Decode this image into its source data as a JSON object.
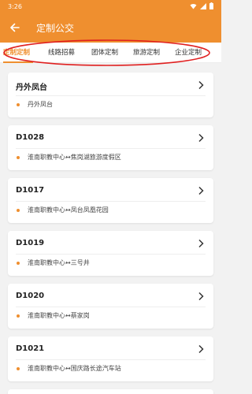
{
  "status_bar": {
    "time": "3:26"
  },
  "header": {
    "title": "定制公交",
    "accent": "#ef8f2f"
  },
  "tabs": [
    {
      "label": "定制定制",
      "active": true
    },
    {
      "label": "线路招募",
      "active": false
    },
    {
      "label": "团体定制",
      "active": false
    },
    {
      "label": "旅游定制",
      "active": false
    },
    {
      "label": "企业定制",
      "active": false
    }
  ],
  "routes": [
    {
      "name": "丹外凤台",
      "stops": "丹外凤台"
    },
    {
      "name": "D1028",
      "stops": "淮南职教中心↔焦岗湖旅游度假区"
    },
    {
      "name": "D1017",
      "stops": "淮南职教中心↔凤台凤凰花园"
    },
    {
      "name": "D1019",
      "stops": "淮南职教中心↔三号井"
    },
    {
      "name": "D1020",
      "stops": "淮南职教中心↔蔡家岗"
    },
    {
      "name": "D1021",
      "stops": "淮南职教中心↔国庆路长途汽车站"
    }
  ]
}
